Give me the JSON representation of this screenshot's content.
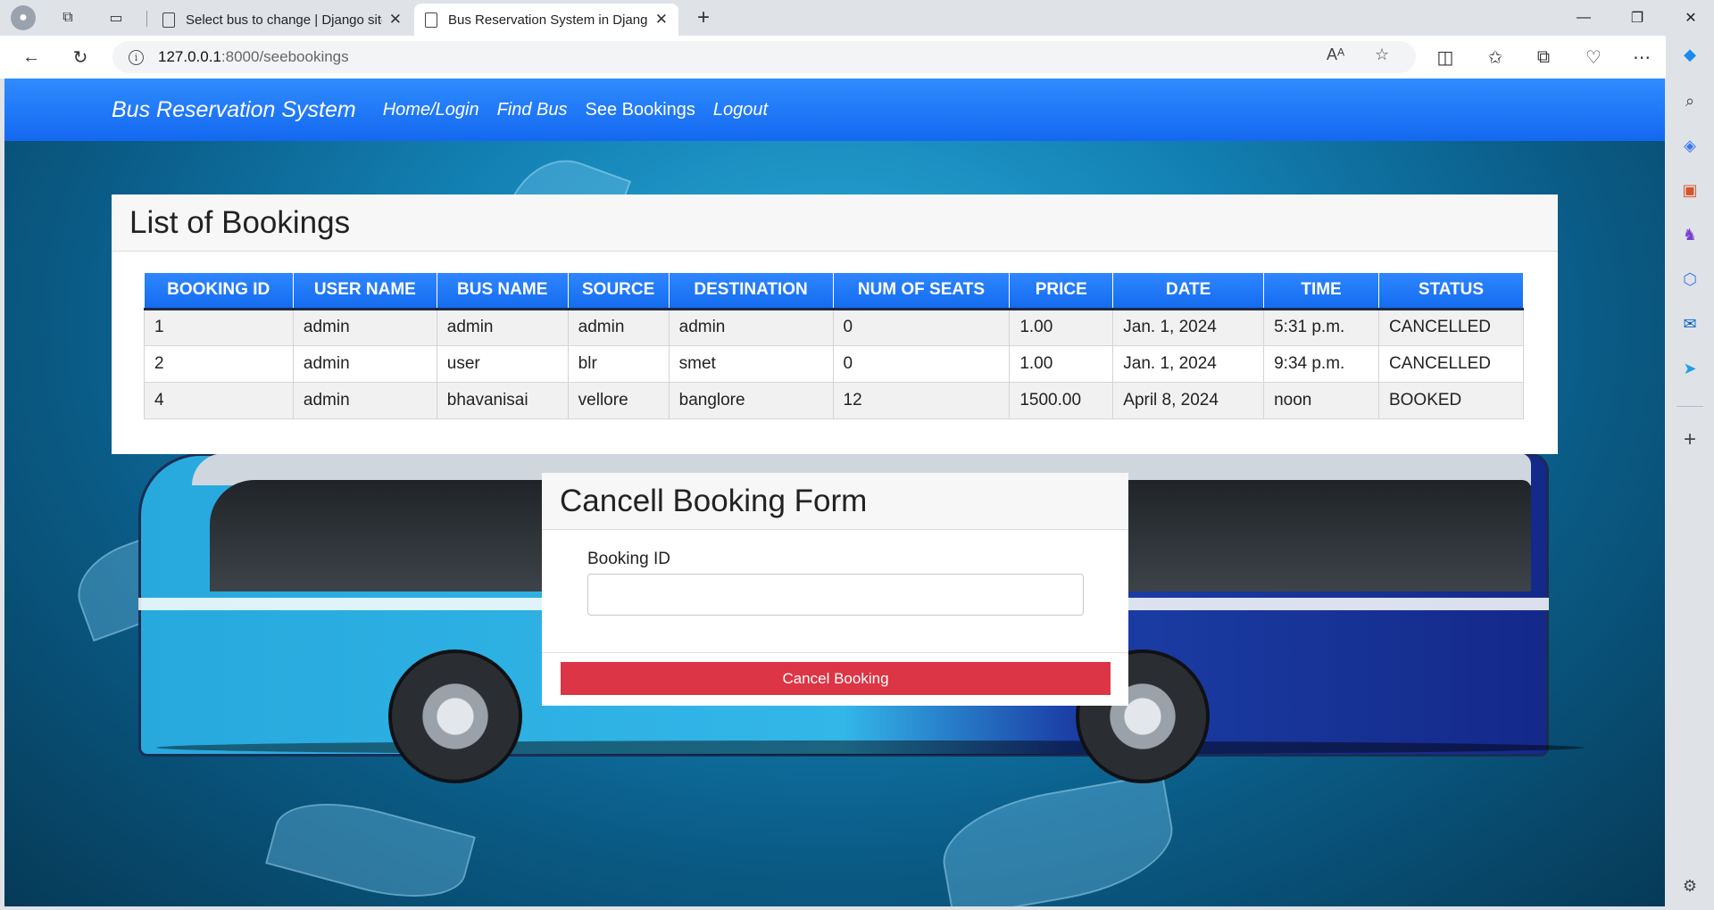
{
  "browser": {
    "tabs": [
      {
        "title": "Select bus to change | Django site admin",
        "active": false
      },
      {
        "title": "Bus Reservation System in Django",
        "active": true
      }
    ],
    "address": {
      "host": "127.0.0.1",
      "path": ":8000/seebookings"
    }
  },
  "navbar": {
    "brand": "Bus Reservation System",
    "links": [
      "Home/Login",
      "Find Bus",
      "See Bookings",
      "Logout"
    ]
  },
  "bookings": {
    "title": "List of Bookings",
    "columns": [
      "BOOKING ID",
      "USER NAME",
      "BUS NAME",
      "SOURCE",
      "DESTINATION",
      "NUM OF SEATS",
      "PRICE",
      "DATE",
      "TIME",
      "STATUS"
    ],
    "rows": [
      [
        "1",
        "admin",
        "admin",
        "admin",
        "admin",
        "0",
        "1.00",
        "Jan. 1, 2024",
        "5:31 p.m.",
        "CANCELLED"
      ],
      [
        "2",
        "admin",
        "user",
        "blr",
        "smet",
        "0",
        "1.00",
        "Jan. 1, 2024",
        "9:34 p.m.",
        "CANCELLED"
      ],
      [
        "4",
        "admin",
        "bhavanisai",
        "vellore",
        "banglore",
        "12",
        "1500.00",
        "April 8, 2024",
        "noon",
        "BOOKED"
      ]
    ]
  },
  "cancel_form": {
    "title": "Cancell Booking Form",
    "label": "Booking ID",
    "input_value": "",
    "button": "Cancel Booking"
  },
  "colors": {
    "navbar": "#1a72f5",
    "table_header": "#1a72f5",
    "cancel_button": "#dc3545"
  }
}
